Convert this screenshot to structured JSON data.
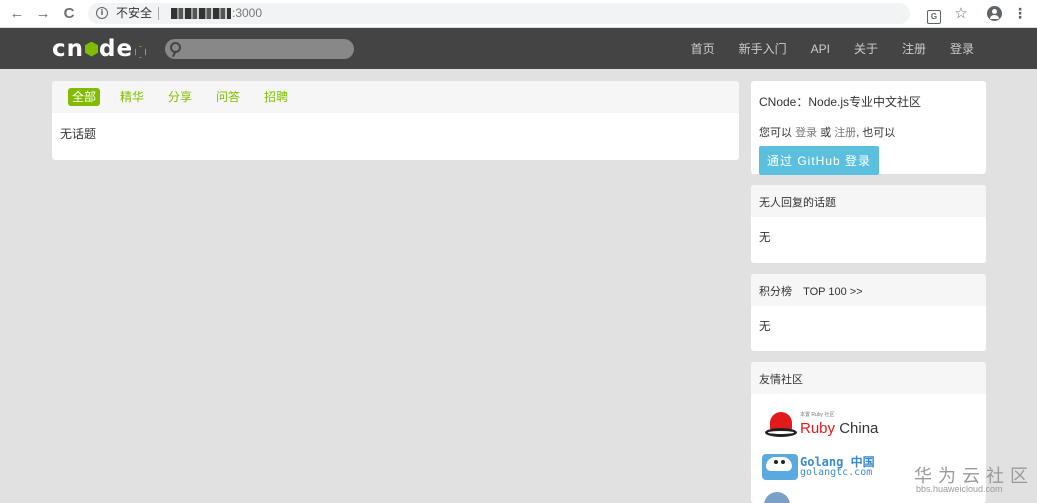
{
  "browser": {
    "back": "←",
    "forward": "→",
    "reload": "C",
    "info": "i",
    "security": "不安全",
    "url_port": ":3000",
    "star": "☆",
    "menu": "⋮",
    "translate": "G"
  },
  "navbar": {
    "logo_c": "c",
    "logo_n": "n",
    "logo_de": "de",
    "search_placeholder": "",
    "links": [
      "首页",
      "新手入门",
      "API",
      "关于",
      "注册",
      "登录"
    ]
  },
  "main": {
    "tabs": [
      "全部",
      "精华",
      "分享",
      "问答",
      "招聘"
    ],
    "active_tab": "全部",
    "empty_text": "无话题"
  },
  "sidebar": {
    "intro": {
      "tagline": "CNode：Node.js专业中文社区",
      "prefix": "您可以",
      "login": "登录",
      "or": "或",
      "register": "注册",
      "suffix": ", 也可以",
      "github_button": "通过 GitHub 登录"
    },
    "no_reply": {
      "title": "无人回复的话题",
      "body": "无"
    },
    "score": {
      "title": "积分榜",
      "top_link": "TOP 100 >>",
      "body": "无"
    },
    "friends": {
      "title": "友情社区",
      "ruby_small": "本置 Ruby 社区",
      "ruby_ruby": "Ruby",
      "ruby_china": " China",
      "golang_title": "Golang 中国",
      "golang_url": "golangtc.com"
    }
  },
  "watermark": {
    "title": "华为云社区",
    "url": "bbs.huaweicloud.com"
  },
  "colors": {
    "brand_green": "#80bd01",
    "navbar_bg": "#444444",
    "github_btn": "#5bc0de",
    "page_bg": "#e1e1e1"
  }
}
